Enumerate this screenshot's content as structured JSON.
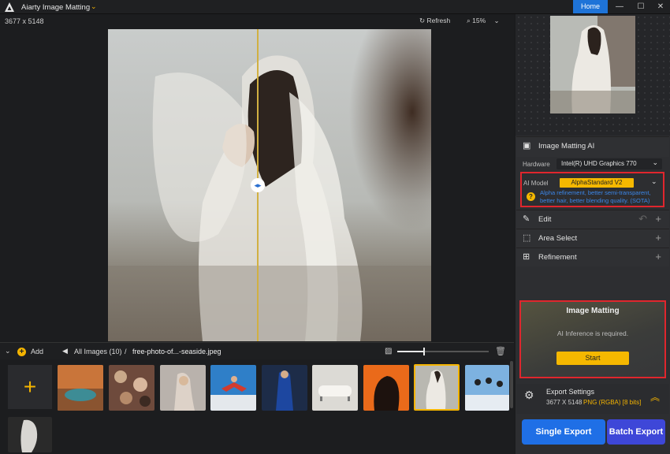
{
  "app": {
    "title": "Aiarty Image Matting",
    "home_label": "Home"
  },
  "viewer": {
    "dimensions": "3677 x 5148",
    "refresh_label": "Refresh",
    "zoom": "15%"
  },
  "sidebar": {
    "section_title": "Image Matting AI",
    "hardware_label": "Hardware",
    "hardware_value": "Intel(R) UHD Graphics 770",
    "ai_model_label": "AI Model",
    "ai_model_value": "AlphaStandard  V2",
    "ai_model_desc": "Alpha refinement, better semi-transparent, better hair, better blending quality. (SOTA)",
    "edit_label": "Edit",
    "area_select_label": "Area Select",
    "refinement_label": "Refinement",
    "matting_title": "Image Matting",
    "matting_msg": "AI Inference is required.",
    "start_label": "Start",
    "export_title": "Export Settings",
    "export_dims": "3677 X 5148",
    "export_format": "PNG (RGBA) [8 bits]",
    "single_export": "Single Export",
    "batch_export": "Batch Export"
  },
  "filmstrip": {
    "add_label": "Add",
    "all_images": "All Images (10)",
    "separator": "/",
    "current_file": "free-photo-of...-seaside.jpeg"
  },
  "colors": {
    "accent": "#f4b400",
    "primary": "#1f6fe6",
    "highlight": "#e0262d"
  }
}
